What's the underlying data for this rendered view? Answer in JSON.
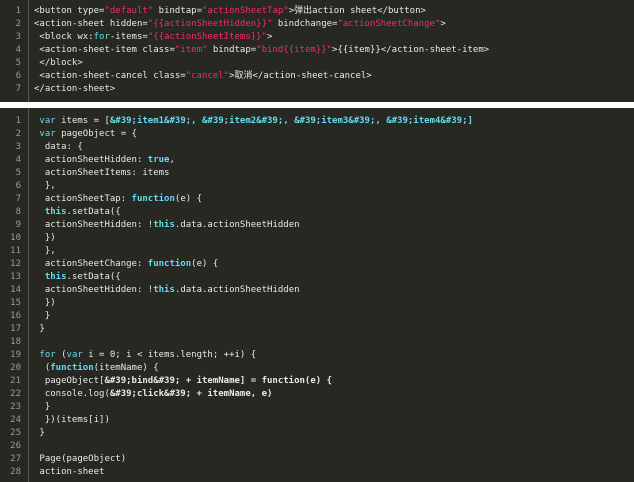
{
  "colors": {
    "background": "#272822",
    "text": "#e8e8e8",
    "string": "#f92672",
    "keyword": "#66d9ef",
    "line_number": "#9a9a9a"
  },
  "top_panel": {
    "lines": [
      {
        "n": "1",
        "segs": [
          {
            "t": "<button type=",
            "c": ""
          },
          {
            "t": "\"default\"",
            "c": "str"
          },
          {
            "t": " bindtap=",
            "c": ""
          },
          {
            "t": "\"actionSheetTap\"",
            "c": "str"
          },
          {
            "t": ">弹出action sheet</button>",
            "c": ""
          }
        ]
      },
      {
        "n": "2",
        "segs": [
          {
            "t": "<action-sheet hidden=",
            "c": ""
          },
          {
            "t": "\"{{actionSheetHidden}}\"",
            "c": "str"
          },
          {
            "t": " bindchange=",
            "c": ""
          },
          {
            "t": "\"actionSheetChange\"",
            "c": "str"
          },
          {
            "t": ">",
            "c": ""
          }
        ]
      },
      {
        "n": "3",
        "segs": [
          {
            "t": " <block wx:",
            "c": ""
          },
          {
            "t": "for",
            "c": "kw"
          },
          {
            "t": "-items=",
            "c": ""
          },
          {
            "t": "\"{{actionSheetItems}}\"",
            "c": "str"
          },
          {
            "t": ">",
            "c": ""
          }
        ]
      },
      {
        "n": "4",
        "segs": [
          {
            "t": " <action-sheet-item class=",
            "c": ""
          },
          {
            "t": "\"item\"",
            "c": "str"
          },
          {
            "t": " bindtap=",
            "c": ""
          },
          {
            "t": "\"bind{{item}}\"",
            "c": "str"
          },
          {
            "t": ">{{item}}</action-sheet-item>",
            "c": ""
          }
        ]
      },
      {
        "n": "5",
        "segs": [
          {
            "t": " </block>",
            "c": ""
          }
        ]
      },
      {
        "n": "6",
        "segs": [
          {
            "t": " <action-sheet-cancel class=",
            "c": ""
          },
          {
            "t": "\"cancel\"",
            "c": "str"
          },
          {
            "t": ">取消</action-sheet-cancel>",
            "c": ""
          }
        ]
      },
      {
        "n": "7",
        "segs": [
          {
            "t": "</action-sheet>",
            "c": ""
          }
        ]
      }
    ]
  },
  "bottom_panel": {
    "lines": [
      {
        "n": "1",
        "segs": [
          {
            "t": " ",
            "c": ""
          },
          {
            "t": "var",
            "c": "kw"
          },
          {
            "t": " items = [",
            "c": ""
          },
          {
            "t": "&#39;item1&#39;, &#39;item2&#39;, &#39;item3&#39;, &#39;item4&#39;]",
            "c": "kwb"
          }
        ]
      },
      {
        "n": "2",
        "segs": [
          {
            "t": " ",
            "c": ""
          },
          {
            "t": "var",
            "c": "kw"
          },
          {
            "t": " pageObject = {",
            "c": ""
          }
        ]
      },
      {
        "n": "3",
        "segs": [
          {
            "t": "  data: {",
            "c": ""
          }
        ]
      },
      {
        "n": "4",
        "segs": [
          {
            "t": "  actionSheetHidden: ",
            "c": ""
          },
          {
            "t": "true",
            "c": "kwb"
          },
          {
            "t": ",",
            "c": ""
          }
        ]
      },
      {
        "n": "5",
        "segs": [
          {
            "t": "  actionSheetItems: items",
            "c": ""
          }
        ]
      },
      {
        "n": "6",
        "segs": [
          {
            "t": "  },",
            "c": ""
          }
        ]
      },
      {
        "n": "7",
        "segs": [
          {
            "t": "  actionSheetTap: ",
            "c": ""
          },
          {
            "t": "function",
            "c": "kwb"
          },
          {
            "t": "(e) {",
            "c": ""
          }
        ]
      },
      {
        "n": "8",
        "segs": [
          {
            "t": "  ",
            "c": ""
          },
          {
            "t": "this",
            "c": "kwb"
          },
          {
            "t": ".setData({",
            "c": ""
          }
        ]
      },
      {
        "n": "9",
        "segs": [
          {
            "t": "  actionSheetHidden: !",
            "c": ""
          },
          {
            "t": "this",
            "c": "kwb"
          },
          {
            "t": ".data.actionSheetHidden",
            "c": ""
          }
        ]
      },
      {
        "n": "10",
        "segs": [
          {
            "t": "  })",
            "c": ""
          }
        ]
      },
      {
        "n": "11",
        "segs": [
          {
            "t": "  },",
            "c": ""
          }
        ]
      },
      {
        "n": "12",
        "segs": [
          {
            "t": "  actionSheetChange: ",
            "c": ""
          },
          {
            "t": "function",
            "c": "kwb"
          },
          {
            "t": "(e) {",
            "c": ""
          }
        ]
      },
      {
        "n": "13",
        "segs": [
          {
            "t": "  ",
            "c": ""
          },
          {
            "t": "this",
            "c": "kwb"
          },
          {
            "t": ".setData({",
            "c": ""
          }
        ]
      },
      {
        "n": "14",
        "segs": [
          {
            "t": "  actionSheetHidden: !",
            "c": ""
          },
          {
            "t": "this",
            "c": "kwb"
          },
          {
            "t": ".data.actionSheetHidden",
            "c": ""
          }
        ]
      },
      {
        "n": "15",
        "segs": [
          {
            "t": "  })",
            "c": ""
          }
        ]
      },
      {
        "n": "16",
        "segs": [
          {
            "t": "  }",
            "c": ""
          }
        ]
      },
      {
        "n": "17",
        "segs": [
          {
            "t": " }",
            "c": ""
          }
        ]
      },
      {
        "n": "18",
        "segs": [
          {
            "t": "",
            "c": ""
          }
        ]
      },
      {
        "n": "19",
        "segs": [
          {
            "t": " ",
            "c": ""
          },
          {
            "t": "for",
            "c": "kw"
          },
          {
            "t": " (",
            "c": ""
          },
          {
            "t": "var",
            "c": "kw"
          },
          {
            "t": " i = 0; i < items.length; ++i) {",
            "c": ""
          }
        ]
      },
      {
        "n": "20",
        "segs": [
          {
            "t": "  (",
            "c": ""
          },
          {
            "t": "function",
            "c": "kwb"
          },
          {
            "t": "(itemName) {",
            "c": ""
          }
        ]
      },
      {
        "n": "21",
        "segs": [
          {
            "t": "  pageObject[",
            "c": ""
          },
          {
            "t": "&#39;bind&#39; + itemName] = function(e) {",
            "c": "bold"
          }
        ]
      },
      {
        "n": "22",
        "segs": [
          {
            "t": "  console.log(",
            "c": ""
          },
          {
            "t": "&#39;click&#39; + itemName, e)",
            "c": "bold"
          }
        ]
      },
      {
        "n": "23",
        "segs": [
          {
            "t": "  }",
            "c": ""
          }
        ]
      },
      {
        "n": "24",
        "segs": [
          {
            "t": "  })(items[i])",
            "c": ""
          }
        ]
      },
      {
        "n": "25",
        "segs": [
          {
            "t": " }",
            "c": ""
          }
        ]
      },
      {
        "n": "26",
        "segs": [
          {
            "t": "",
            "c": ""
          }
        ]
      },
      {
        "n": "27",
        "segs": [
          {
            "t": " Page(pageObject)",
            "c": ""
          }
        ]
      },
      {
        "n": "28",
        "segs": [
          {
            "t": " action-sheet",
            "c": ""
          }
        ]
      }
    ]
  }
}
